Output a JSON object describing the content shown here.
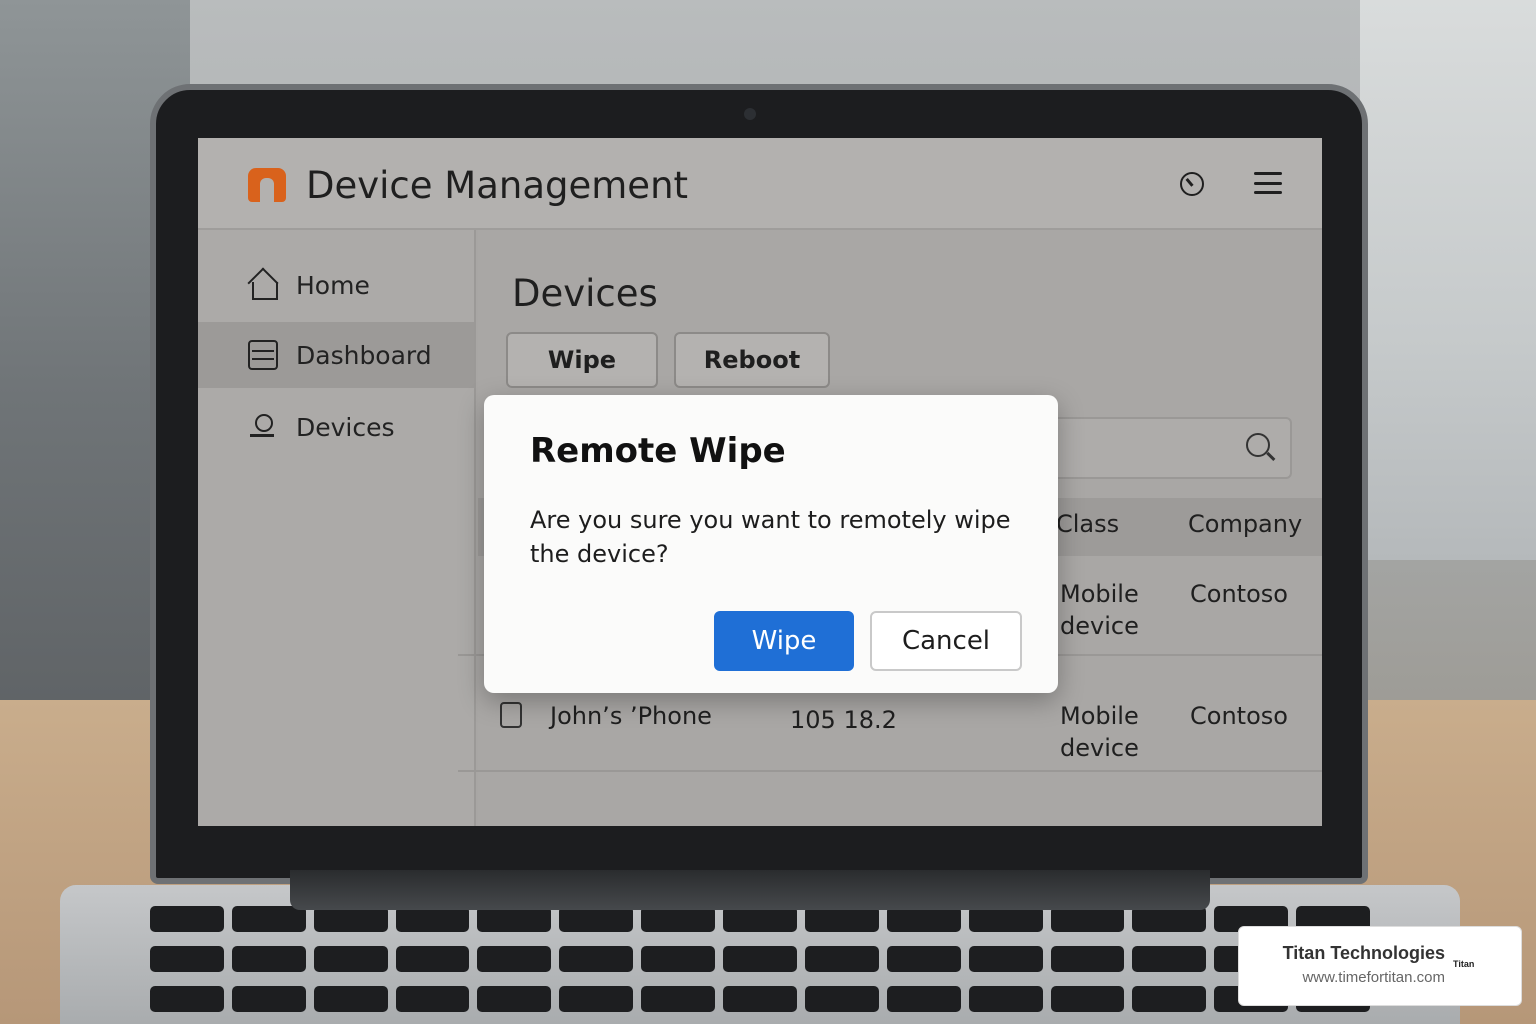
{
  "app": {
    "title": "Device Management"
  },
  "sidebar": {
    "items": [
      {
        "label": "Home",
        "icon": "home-icon"
      },
      {
        "label": "Dashboard",
        "icon": "dashboard-icon",
        "active": true
      },
      {
        "label": "Devices",
        "icon": "devices-icon"
      }
    ]
  },
  "main": {
    "page_title": "Devices",
    "toolbar": {
      "wipe_label": "Wipe",
      "reboot_label": "Reboot"
    },
    "table": {
      "columns": [
        "Class",
        "Company"
      ],
      "rows": [
        {
          "name": "",
          "ip": "",
          "class": "Mobile device",
          "company": "Contoso"
        },
        {
          "name": "John’s ’Phone",
          "ip": "105 18.2",
          "class": "Mobile device",
          "company": "Contoso"
        }
      ]
    }
  },
  "modal": {
    "title": "Remote Wipe",
    "message": "Are you sure you want to remotely wipe the device?",
    "confirm_label": "Wipe",
    "cancel_label": "Cancel"
  },
  "watermark": {
    "company": "Titan Technologies",
    "url": "www.timefortitan.com",
    "logo_text": "Titan"
  },
  "colors": {
    "accent": "#1f6fd6",
    "brand": "#d9621c"
  }
}
